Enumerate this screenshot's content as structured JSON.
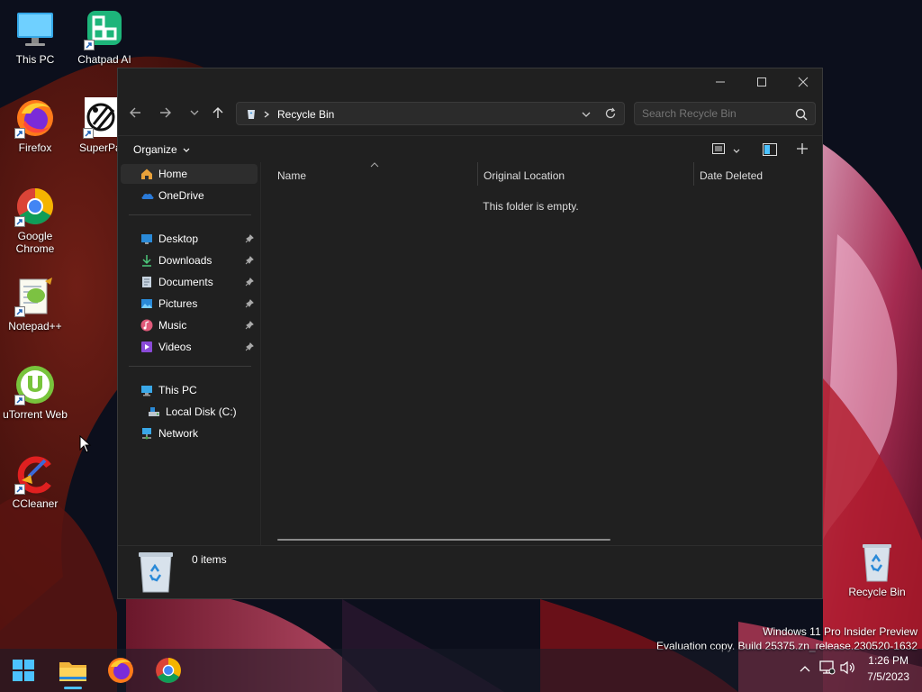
{
  "desktop": {
    "icons": [
      {
        "label": "This PC"
      },
      {
        "label": "Chatpad AI"
      },
      {
        "label": "Firefox"
      },
      {
        "label": "SuperPa"
      },
      {
        "label": "Google Chrome"
      },
      {
        "label": "Notepad++"
      },
      {
        "label": "uTorrent Web"
      },
      {
        "label": "CCleaner"
      }
    ],
    "recycle_bin_label": "Recycle Bin",
    "watermark": {
      "line1": "Windows 11 Pro Insider Preview",
      "line2": "Evaluation copy. Build 25375.zn_release.230520-1632"
    }
  },
  "explorer": {
    "address_path": "Recycle Bin",
    "search_placeholder": "Search Recycle Bin",
    "organize_label": "Organize",
    "nav": {
      "home": "Home",
      "onedrive": "OneDrive",
      "quick_access": [
        {
          "label": "Desktop"
        },
        {
          "label": "Downloads"
        },
        {
          "label": "Documents"
        },
        {
          "label": "Pictures"
        },
        {
          "label": "Music"
        },
        {
          "label": "Videos"
        }
      ],
      "this_pc": "This PC",
      "local_disk": "Local Disk (C:)",
      "network": "Network"
    },
    "columns": [
      "Name",
      "Original Location",
      "Date Deleted"
    ],
    "empty_message": "This folder is empty.",
    "item_count": "0 items"
  },
  "taskbar": {
    "time": "1:26 PM",
    "date": "7/5/2023"
  },
  "colors": {
    "window_bg": "#202020",
    "accent": "#4cc2ff"
  }
}
